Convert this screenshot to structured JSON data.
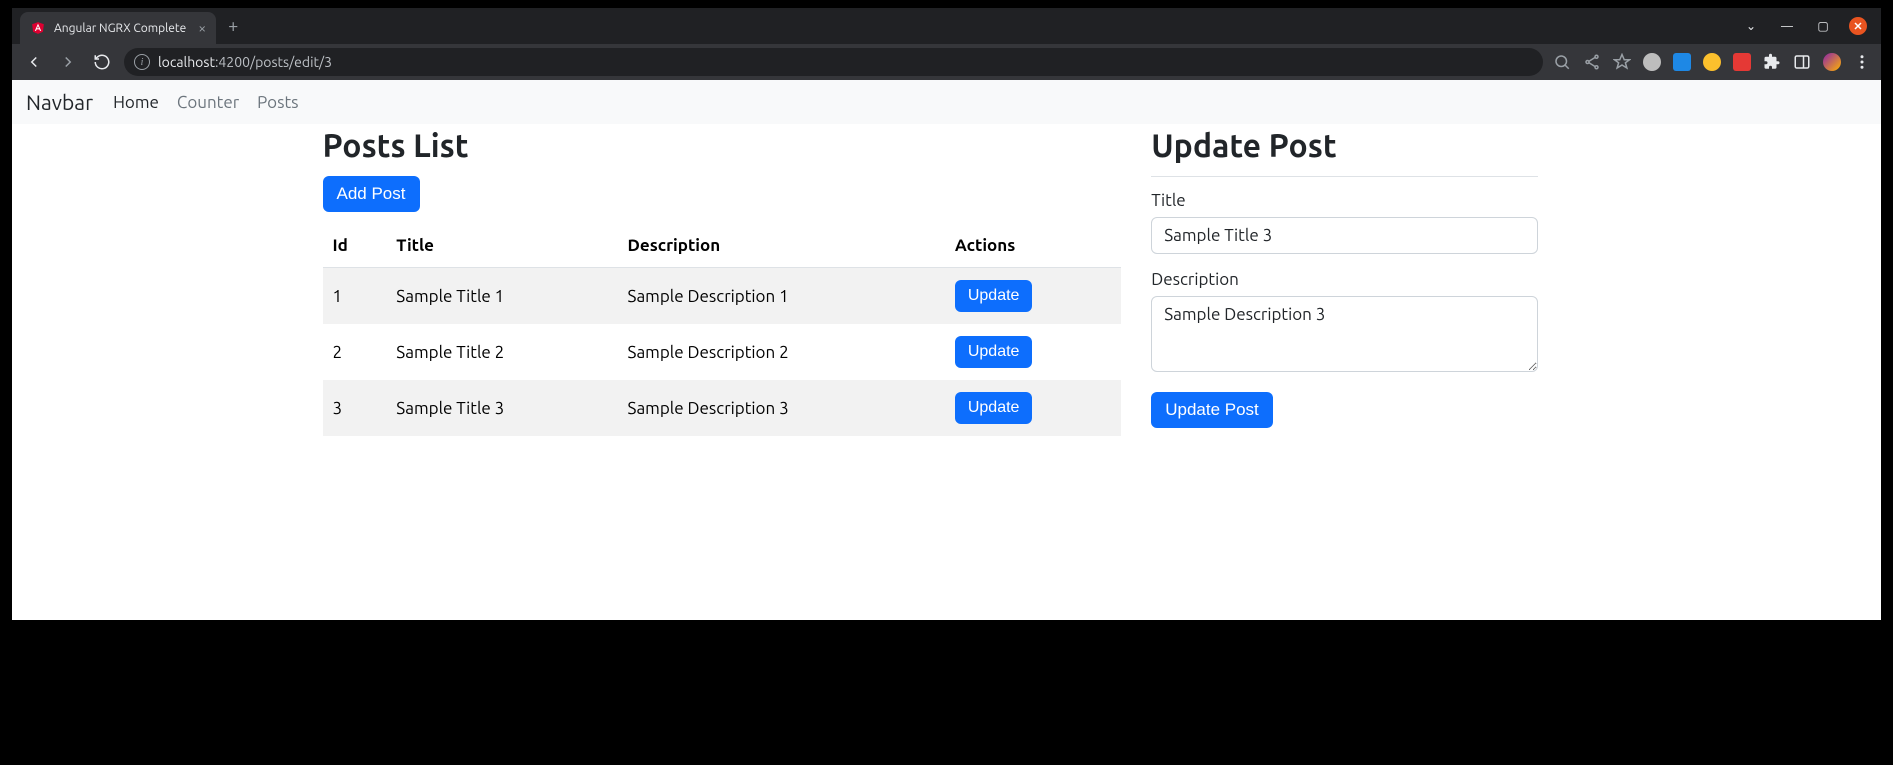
{
  "browser": {
    "tab_title": "Angular NGRX Complete",
    "url_host": "localhost",
    "url_port_path": ":4200/posts/edit/3"
  },
  "navbar": {
    "brand": "Navbar",
    "links": [
      {
        "label": "Home",
        "active": true
      },
      {
        "label": "Counter",
        "active": false
      },
      {
        "label": "Posts",
        "active": false
      }
    ]
  },
  "posts_list": {
    "heading": "Posts List",
    "add_button": "Add Post",
    "columns": {
      "id": "Id",
      "title": "Title",
      "description": "Description",
      "actions": "Actions"
    },
    "rows": [
      {
        "id": "1",
        "title": "Sample Title 1",
        "description": "Sample Description 1",
        "action": "Update"
      },
      {
        "id": "2",
        "title": "Sample Title 2",
        "description": "Sample Description 2",
        "action": "Update"
      },
      {
        "id": "3",
        "title": "Sample Title 3",
        "description": "Sample Description 3",
        "action": "Update"
      }
    ]
  },
  "update_form": {
    "heading": "Update Post",
    "title_label": "Title",
    "title_value": "Sample Title 3",
    "description_label": "Description",
    "description_value": "Sample Description 3",
    "submit_button": "Update Post"
  }
}
